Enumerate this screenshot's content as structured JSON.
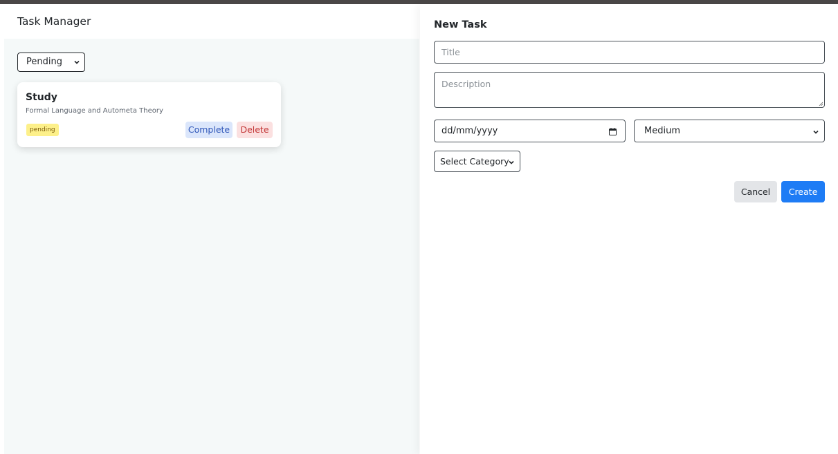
{
  "app": {
    "title": "Task Manager"
  },
  "filter": {
    "selected": "Pending"
  },
  "tasks": [
    {
      "title": "Study",
      "description": "Formal Language and Autometa Theory",
      "status": "pending",
      "complete_label": "Complete",
      "delete_label": "Delete"
    }
  ],
  "form": {
    "heading": "New Task",
    "title_placeholder": "Title",
    "description_placeholder": "Description",
    "date_placeholder": "dd/mm/yyyy",
    "priority_selected": "Medium",
    "category_selected": "Select Category",
    "cancel_label": "Cancel",
    "create_label": "Create"
  },
  "colors": {
    "topbar": "#4a4747",
    "left_background": "#f5f9f9",
    "badge_pending": "#fdf08a",
    "complete_button_bg": "#dbe6fb",
    "delete_button_bg": "#fbe0e0",
    "create_button_bg": "#1e7cf5",
    "cancel_button_bg": "#e3e5e8"
  },
  "icons": {
    "select_chevron": "chevron-down-icon",
    "date_picker": "calendar-icon",
    "textarea_resize": "resize-handle-icon"
  }
}
